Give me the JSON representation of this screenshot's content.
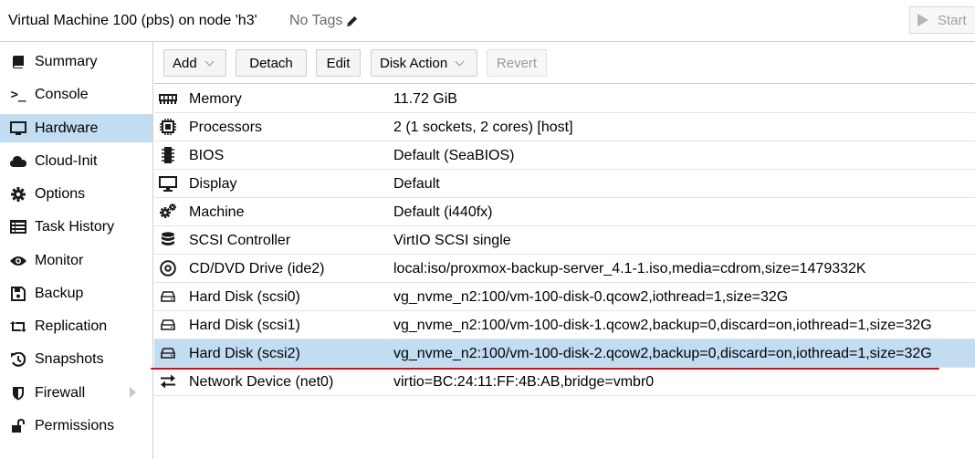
{
  "header": {
    "vm_title": "Virtual Machine 100 (pbs) on node 'h3'",
    "tags": "No Tags",
    "start_label": "Start"
  },
  "sidebar": {
    "items": [
      {
        "label": "Summary",
        "icon": "book-icon"
      },
      {
        "label": "Console",
        "icon": "terminal-icon"
      },
      {
        "label": "Hardware",
        "icon": "monitor-icon",
        "active": true
      },
      {
        "label": "Cloud-Init",
        "icon": "cloud-icon"
      },
      {
        "label": "Options",
        "icon": "gear-icon"
      },
      {
        "label": "Task History",
        "icon": "list-icon"
      },
      {
        "label": "Monitor",
        "icon": "eye-icon"
      },
      {
        "label": "Backup",
        "icon": "floppy-icon"
      },
      {
        "label": "Replication",
        "icon": "retweet-icon"
      },
      {
        "label": "Snapshots",
        "icon": "history-icon"
      },
      {
        "label": "Firewall",
        "icon": "shield-icon"
      },
      {
        "label": "Permissions",
        "icon": "unlock-icon"
      }
    ]
  },
  "toolbar": {
    "add_label": "Add",
    "detach_label": "Detach",
    "edit_label": "Edit",
    "disk_action_label": "Disk Action",
    "revert_label": "Revert"
  },
  "hardware": {
    "rows": [
      {
        "name": "Memory",
        "value": "11.72 GiB",
        "icon": "memory-icon"
      },
      {
        "name": "Processors",
        "value": "2 (1 sockets, 2 cores) [host]",
        "icon": "cpu-icon"
      },
      {
        "name": "BIOS",
        "value": "Default (SeaBIOS)",
        "icon": "microchip-icon"
      },
      {
        "name": "Display",
        "value": "Default",
        "icon": "desktop-icon"
      },
      {
        "name": "Machine",
        "value": "Default (i440fx)",
        "icon": "cogs-icon"
      },
      {
        "name": "SCSI Controller",
        "value": "VirtIO SCSI single",
        "icon": "database-icon"
      },
      {
        "name": "CD/DVD Drive (ide2)",
        "value": "local:iso/proxmox-backup-server_4.1-1.iso,media=cdrom,size=1479332K",
        "icon": "cdrom-icon"
      },
      {
        "name": "Hard Disk (scsi0)",
        "value": "vg_nvme_n2:100/vm-100-disk-0.qcow2,iothread=1,size=32G",
        "icon": "hdd-icon"
      },
      {
        "name": "Hard Disk (scsi1)",
        "value": "vg_nvme_n2:100/vm-100-disk-1.qcow2,backup=0,discard=on,iothread=1,size=32G",
        "icon": "hdd-icon"
      },
      {
        "name": "Hard Disk (scsi2)",
        "value": "vg_nvme_n2:100/vm-100-disk-2.qcow2,backup=0,discard=on,iothread=1,size=32G",
        "icon": "hdd-icon",
        "selected": true
      },
      {
        "name": "Network Device (net0)",
        "value": "virtio=BC:24:11:FF:4B:AB,bridge=vmbr0",
        "icon": "exchange-icon"
      }
    ]
  },
  "colors": {
    "selection": "#c2ddf2",
    "annotation": "#d0101a"
  }
}
